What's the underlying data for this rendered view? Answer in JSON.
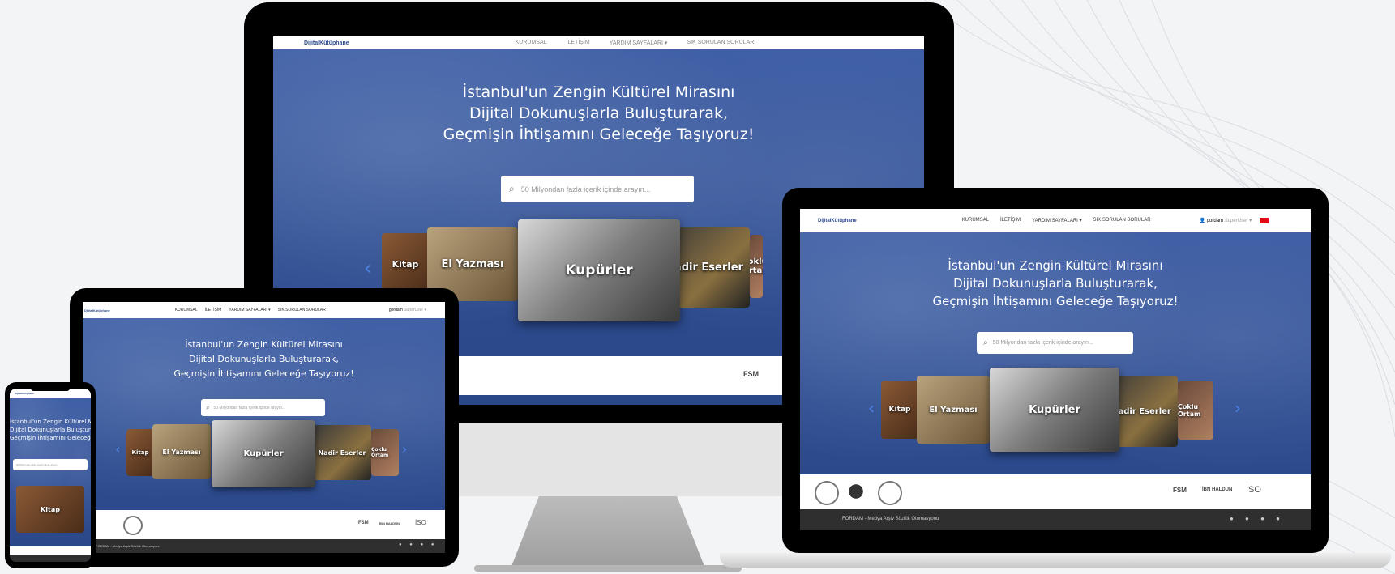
{
  "site": {
    "logo_text": "DijitalKütüphane",
    "menu": [
      "KURUMSAL",
      "İLETİŞİM",
      "YARDIM SAYFALARI ▾",
      "SIK SORULAN SORULAR"
    ],
    "user": "gordam",
    "user_role": "SuperUser ▾",
    "headline_lines": [
      "İstanbul'un Zengin Kültürel Mirasını",
      "Dijital Dokunuşlarla Buluşturarak,",
      "Geçmişin İhtişamını Geleceğe Taşıyoruz!"
    ],
    "search_placeholder": "50 Milyondan fazla içerik içinde arayın...",
    "categories": [
      "Kitap",
      "El Yazması",
      "Kupürler",
      "Nadir Eserler",
      "Çoklu Ortam"
    ],
    "partners": [
      "FSM",
      "İBN HALDUN",
      "İSO"
    ],
    "footer_text": "FORDAM - Medya Arşiv Sözlük Otomasyonu",
    "phone_card_label": "Kitap"
  },
  "colors": {
    "hero": "#3b5fa6",
    "arrow": "#4e84e6",
    "frame": "#000000",
    "footer": "#2f2f2f"
  }
}
